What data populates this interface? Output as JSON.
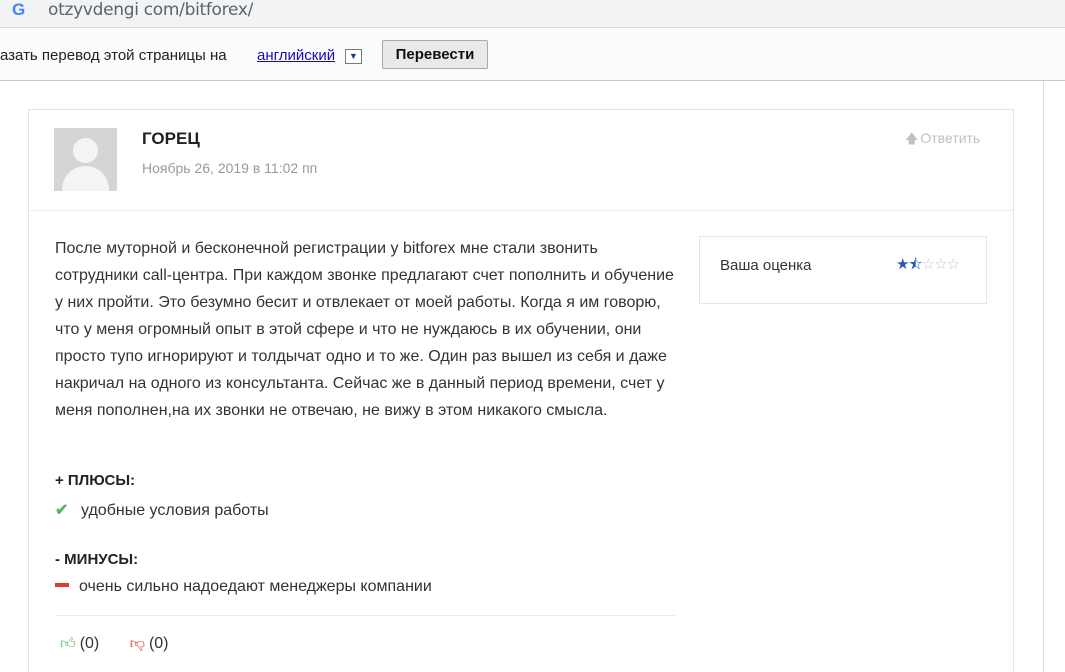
{
  "browser": {
    "url": "otzyvdengi com/bitforex/"
  },
  "translate_bar": {
    "text": "азать перевод этой страницы на",
    "language": "английский",
    "dropdown_glyph": "▼",
    "button_label": "Перевести"
  },
  "review": {
    "author": "ГОРЕЦ",
    "date": "Ноябрь 26, 2019 в 11:02 пп",
    "reply_label": "Ответить",
    "text": "После муторной и бесконечной регистрации у bitforex мне стали звонить сотрудники call-центра. При каждом звонке предлагают счет пополнить и обучение у них пройти. Это безумно бесит и отвлекает от моей работы. Когда я им говорю, что у меня огромный опыт в этой сфере и что не нуждаюсь в их обучении, они просто тупо игнорируют и толдычат одно и то же. Один раз вышел из себя и даже накричал на одного из консультанта. Сейчас же в данный период времени, счет у меня пополнен,на их звонки не отвечаю, не вижу в этом никакого смысла.",
    "rating_label": "Ваша оценка",
    "rating_value": 1.5,
    "rating_max": 5,
    "pros_title": "+ ПЛЮСЫ:",
    "pros": [
      "удобные условия работы"
    ],
    "cons_title": "- МИНУСЫ:",
    "cons": [
      "очень сильно надоедают менеджеры компании"
    ],
    "likes": "(0)",
    "dislikes": "(0)"
  },
  "colors": {
    "accent_blue": "#2b5aa8",
    "pro_green": "#5cb85c",
    "con_red": "#e33b2e"
  }
}
